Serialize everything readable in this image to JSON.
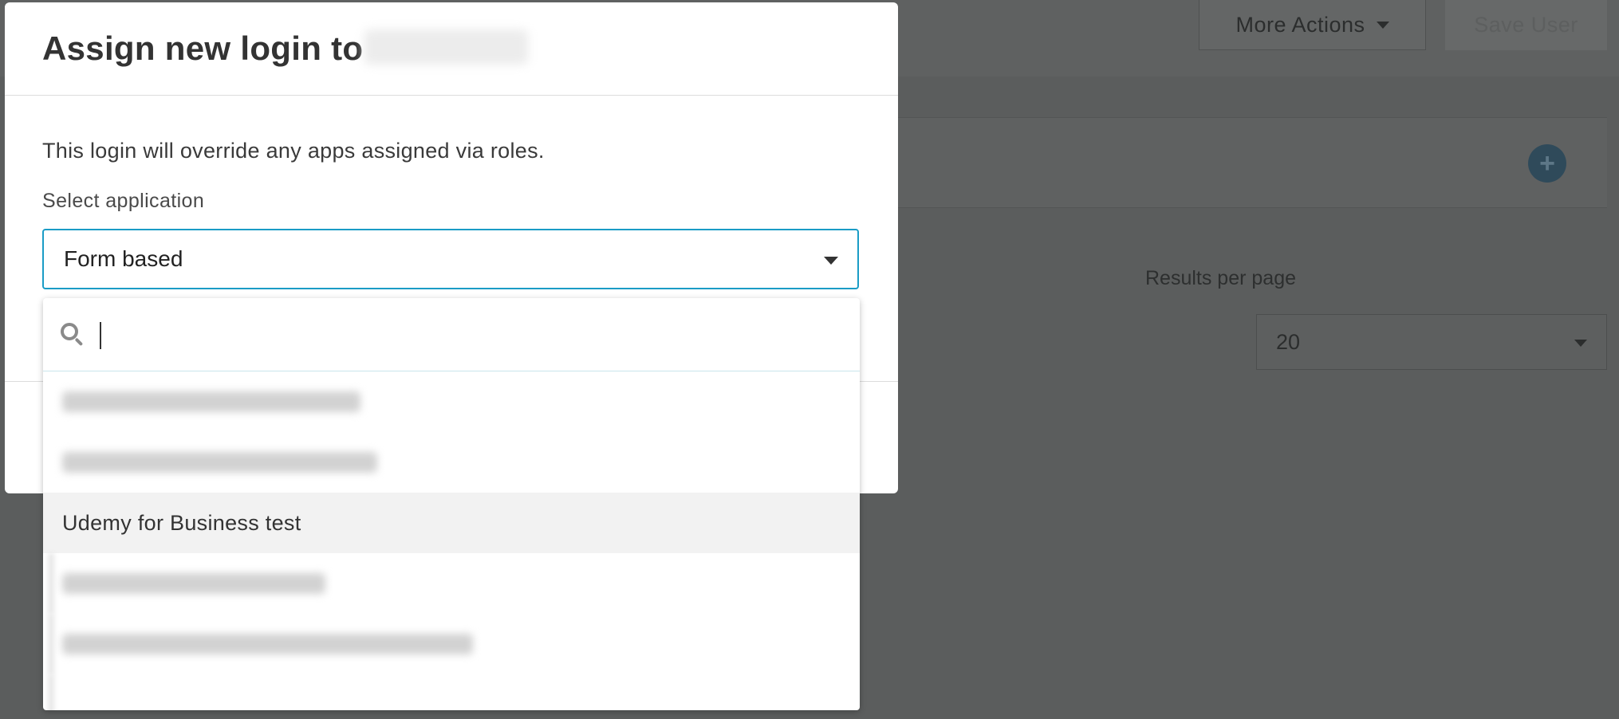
{
  "background": {
    "more_actions_label": "More Actions",
    "save_user_label": "Save User",
    "results_per_page_label": "Results per page",
    "results_per_page_value": "20"
  },
  "modal": {
    "title_prefix": "Assign new login to",
    "notice": "This login will override any apps assigned via roles.",
    "select_label": "Select application",
    "selected_value": "Form based"
  },
  "dropdown": {
    "search_value": "",
    "visible_option": "Udemy for Business test"
  },
  "colors": {
    "focus_border": "#1a9cc6",
    "overlay": "#5b5d5d",
    "highlight_row": "#f2f2f2"
  }
}
